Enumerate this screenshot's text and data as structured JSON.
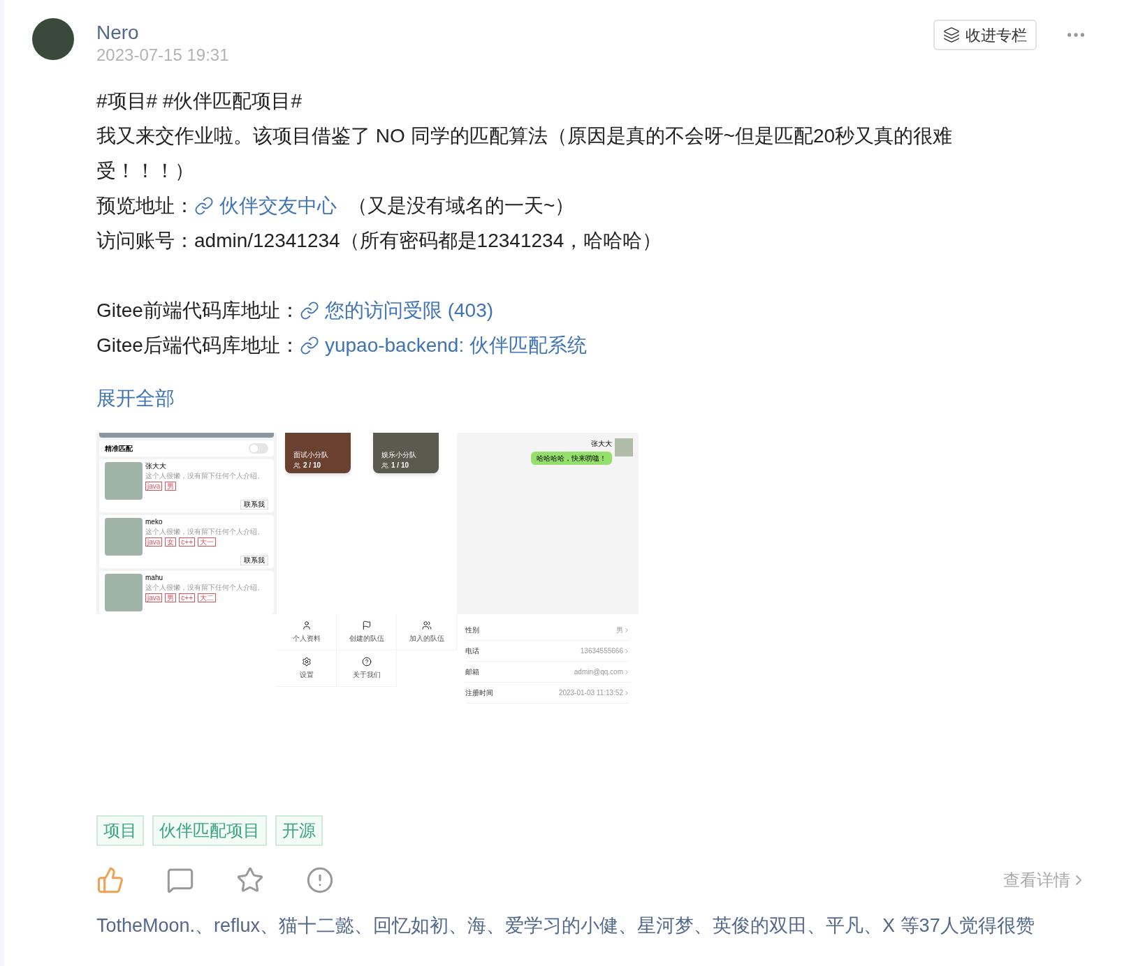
{
  "author": {
    "name": "Nero",
    "time": "2023-07-15 19:31"
  },
  "collect_button": {
    "label": "收进专栏"
  },
  "content": {
    "hashtags": "#项目# #伙伴匹配项目#",
    "paragraph": "我又来交作业啦。该项目借鉴了 NO 同学的匹配算法（原因是真的不会呀~但是匹配20秒又真的很难受！！！）",
    "preview": {
      "label": "预览地址：",
      "link": "伙伴交友中心",
      "suffix": "（又是没有域名的一天~）"
    },
    "account": "访问账号：admin/12341234（所有密码都是12341234，哈哈哈）",
    "repos": [
      {
        "label": "Gitee前端代码库地址：",
        "link": "您的访问受限 (403)"
      },
      {
        "label": "Gitee后端代码库地址：",
        "link": "yupao-backend: 伙伴匹配系统"
      }
    ],
    "expand": "展开全部"
  },
  "images": {
    "match": {
      "switch_label": "精准匹配",
      "switch_on": false,
      "users": [
        {
          "name": "张大大",
          "bio": "这个人很懒，没有留下任何个人介绍。",
          "tags": [
            "java",
            "男"
          ],
          "contact": "联系我"
        },
        {
          "name": "meko",
          "bio": "这个人很懒，没有留下任何个人介绍。",
          "tags": [
            "java",
            "女",
            "c++",
            "大一"
          ],
          "contact": "联系我"
        },
        {
          "name": "mahu",
          "bio": "这个人很懒，没有留下任何个人介绍。",
          "tags": [
            "java",
            "男",
            "c++",
            "大二"
          ]
        }
      ]
    },
    "teams": [
      {
        "name": "面试小分队",
        "count": "2 / 10"
      },
      {
        "name": "娱乐小分队",
        "count": "1 / 10"
      }
    ],
    "chat": {
      "sender": "张大大",
      "message": "哈哈哈哈，快来唠嗑！"
    },
    "menu": [
      {
        "kind": "profile",
        "label": "个人资料"
      },
      {
        "kind": "create",
        "label": "创建的队伍"
      },
      {
        "kind": "joined",
        "label": "加入的队伍"
      },
      {
        "kind": "settings",
        "label": "设置"
      },
      {
        "kind": "about",
        "label": "关于我们"
      }
    ],
    "profile": [
      {
        "label": "性别",
        "value": "男"
      },
      {
        "label": "电话",
        "value": "13634555666"
      },
      {
        "label": "邮箱",
        "value": "admin@qq.com"
      },
      {
        "label": "注册时间",
        "value": "2023-01-03 11:13:52"
      }
    ]
  },
  "tags": [
    "项目",
    "伙伴匹配项目",
    "开源"
  ],
  "actions": {
    "liked": true,
    "details": "查看详情"
  },
  "likes": "TotheMoon.、reflux、猫十二懿、回忆如初、海、爱学习的小健、星河梦、英俊的双田、平凡、X 等37人觉得很赞"
}
